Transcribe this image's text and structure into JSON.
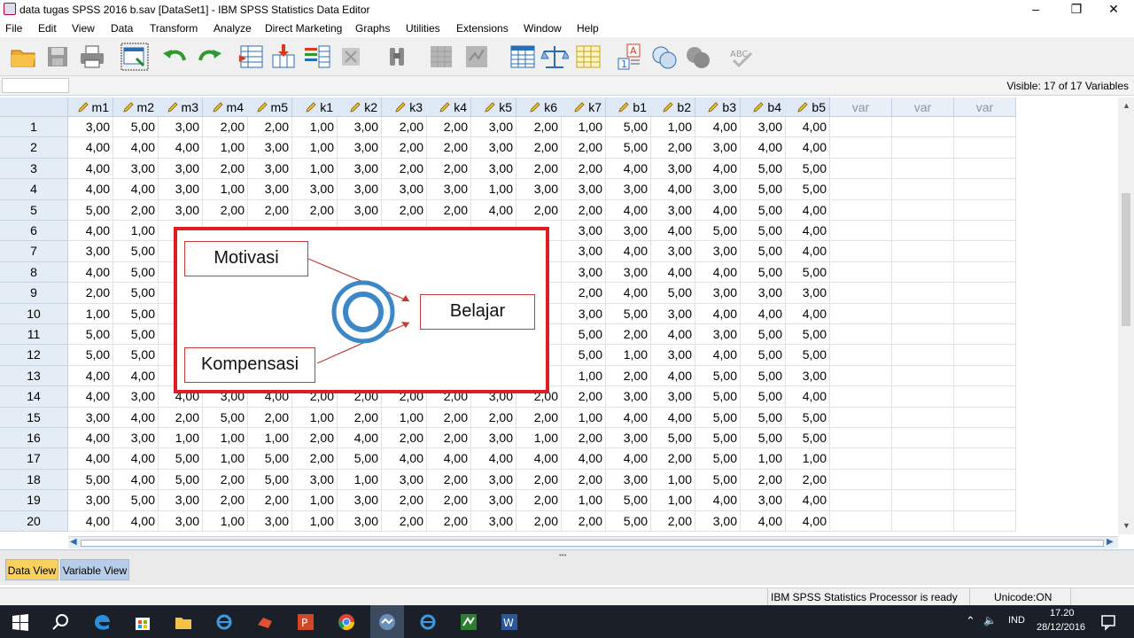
{
  "window": {
    "title": "data tugas SPSS 2016 b.sav [DataSet1] - IBM SPSS Statistics Data Editor"
  },
  "menu": [
    "File",
    "Edit",
    "View",
    "Data",
    "Transform",
    "Analyze",
    "Direct Marketing",
    "Graphs",
    "Utilities",
    "Extensions",
    "Window",
    "Help"
  ],
  "toolbar_icons": [
    "open-icon",
    "save-icon",
    "print-icon",
    "recall-dialog-icon",
    "undo-icon",
    "redo-icon",
    "go-to-case-icon",
    "go-to-variable-icon",
    "variables-icon",
    "find-icon",
    "insert-cases-icon",
    "insert-variable-icon",
    "split-file-icon",
    "weight-cases-icon",
    "select-cases-icon",
    "value-labels-icon",
    "use-sets-icon",
    "show-all-variables-icon",
    "spelling-icon"
  ],
  "visible_label": "Visible: 17 of 17 Variables",
  "columns": [
    "m1",
    "m2",
    "m3",
    "m4",
    "m5",
    "k1",
    "k2",
    "k3",
    "k4",
    "k5",
    "k6",
    "k7",
    "b1",
    "b2",
    "b3",
    "b4",
    "b5"
  ],
  "empty_columns": [
    "var",
    "var",
    "var"
  ],
  "rows": [
    [
      "3,00",
      "5,00",
      "3,00",
      "2,00",
      "2,00",
      "1,00",
      "3,00",
      "2,00",
      "2,00",
      "3,00",
      "2,00",
      "1,00",
      "5,00",
      "1,00",
      "4,00",
      "3,00",
      "4,00"
    ],
    [
      "4,00",
      "4,00",
      "4,00",
      "1,00",
      "3,00",
      "1,00",
      "3,00",
      "2,00",
      "2,00",
      "3,00",
      "2,00",
      "2,00",
      "5,00",
      "2,00",
      "3,00",
      "4,00",
      "4,00"
    ],
    [
      "4,00",
      "3,00",
      "3,00",
      "2,00",
      "3,00",
      "1,00",
      "3,00",
      "2,00",
      "2,00",
      "3,00",
      "2,00",
      "2,00",
      "4,00",
      "3,00",
      "4,00",
      "5,00",
      "5,00"
    ],
    [
      "4,00",
      "4,00",
      "3,00",
      "1,00",
      "3,00",
      "3,00",
      "3,00",
      "3,00",
      "3,00",
      "1,00",
      "3,00",
      "3,00",
      "3,00",
      "4,00",
      "3,00",
      "5,00",
      "5,00"
    ],
    [
      "5,00",
      "2,00",
      "3,00",
      "2,00",
      "2,00",
      "2,00",
      "3,00",
      "2,00",
      "2,00",
      "4,00",
      "2,00",
      "2,00",
      "4,00",
      "3,00",
      "4,00",
      "5,00",
      "4,00"
    ],
    [
      "4,00",
      "1,00",
      "",
      "",
      "",
      "",
      "",
      "",
      "",
      "",
      "",
      "3,00",
      "3,00",
      "4,00",
      "5,00",
      "5,00",
      "4,00"
    ],
    [
      "3,00",
      "5,00",
      "",
      "",
      "",
      "",
      "",
      "",
      "",
      "",
      "",
      "3,00",
      "4,00",
      "3,00",
      "3,00",
      "5,00",
      "4,00"
    ],
    [
      "4,00",
      "5,00",
      "",
      "",
      "",
      "",
      "",
      "",
      "",
      "",
      "",
      "3,00",
      "3,00",
      "4,00",
      "4,00",
      "5,00",
      "5,00"
    ],
    [
      "2,00",
      "5,00",
      "",
      "",
      "",
      "",
      "",
      "",
      "",
      "",
      "",
      "2,00",
      "4,00",
      "5,00",
      "3,00",
      "3,00",
      "3,00"
    ],
    [
      "1,00",
      "5,00",
      "",
      "",
      "",
      "",
      "",
      "",
      "",
      "",
      "",
      "3,00",
      "5,00",
      "3,00",
      "4,00",
      "4,00",
      "4,00"
    ],
    [
      "5,00",
      "5,00",
      "",
      "",
      "",
      "",
      "",
      "",
      "",
      "",
      "",
      "5,00",
      "2,00",
      "4,00",
      "3,00",
      "5,00",
      "5,00"
    ],
    [
      "5,00",
      "5,00",
      "",
      "",
      "",
      "",
      "",
      "",
      "",
      "",
      "",
      "5,00",
      "1,00",
      "3,00",
      "4,00",
      "5,00",
      "5,00"
    ],
    [
      "4,00",
      "4,00",
      "",
      "",
      "",
      "",
      "",
      "",
      "",
      "",
      "",
      "1,00",
      "2,00",
      "4,00",
      "5,00",
      "5,00",
      "3,00"
    ],
    [
      "4,00",
      "3,00",
      "4,00",
      "3,00",
      "4,00",
      "2,00",
      "2,00",
      "2,00",
      "2,00",
      "3,00",
      "2,00",
      "2,00",
      "3,00",
      "3,00",
      "5,00",
      "5,00",
      "4,00"
    ],
    [
      "3,00",
      "4,00",
      "2,00",
      "5,00",
      "2,00",
      "1,00",
      "2,00",
      "1,00",
      "2,00",
      "2,00",
      "2,00",
      "1,00",
      "4,00",
      "4,00",
      "5,00",
      "5,00",
      "5,00"
    ],
    [
      "4,00",
      "3,00",
      "1,00",
      "1,00",
      "1,00",
      "2,00",
      "4,00",
      "2,00",
      "2,00",
      "3,00",
      "1,00",
      "2,00",
      "3,00",
      "5,00",
      "5,00",
      "5,00",
      "5,00"
    ],
    [
      "4,00",
      "4,00",
      "5,00",
      "1,00",
      "5,00",
      "2,00",
      "5,00",
      "4,00",
      "4,00",
      "4,00",
      "4,00",
      "4,00",
      "4,00",
      "2,00",
      "5,00",
      "1,00",
      "1,00"
    ],
    [
      "5,00",
      "4,00",
      "5,00",
      "2,00",
      "5,00",
      "3,00",
      "1,00",
      "3,00",
      "2,00",
      "3,00",
      "2,00",
      "2,00",
      "3,00",
      "1,00",
      "5,00",
      "2,00",
      "2,00"
    ],
    [
      "3,00",
      "5,00",
      "3,00",
      "2,00",
      "2,00",
      "1,00",
      "3,00",
      "2,00",
      "2,00",
      "3,00",
      "2,00",
      "1,00",
      "5,00",
      "1,00",
      "4,00",
      "3,00",
      "4,00"
    ],
    [
      "4,00",
      "4,00",
      "3,00",
      "1,00",
      "3,00",
      "1,00",
      "3,00",
      "2,00",
      "2,00",
      "3,00",
      "2,00",
      "2,00",
      "5,00",
      "2,00",
      "3,00",
      "4,00",
      "4,00"
    ]
  ],
  "overlay": {
    "motivasi": "Motivasi",
    "kompensasi": "Kompensasi",
    "belajar": "Belajar"
  },
  "tabs": {
    "data_view": "Data View",
    "variable_view": "Variable View"
  },
  "status": {
    "processor": "IBM SPSS Statistics Processor is ready",
    "encoding": "Unicode:ON"
  },
  "taskbar": {
    "language": "IND",
    "time": "17.20",
    "date": "28/12/2016"
  },
  "colors": {
    "overlay_border": "#e01c23",
    "active_tab": "#f7d060",
    "header_bg": "#dfe9f5"
  }
}
